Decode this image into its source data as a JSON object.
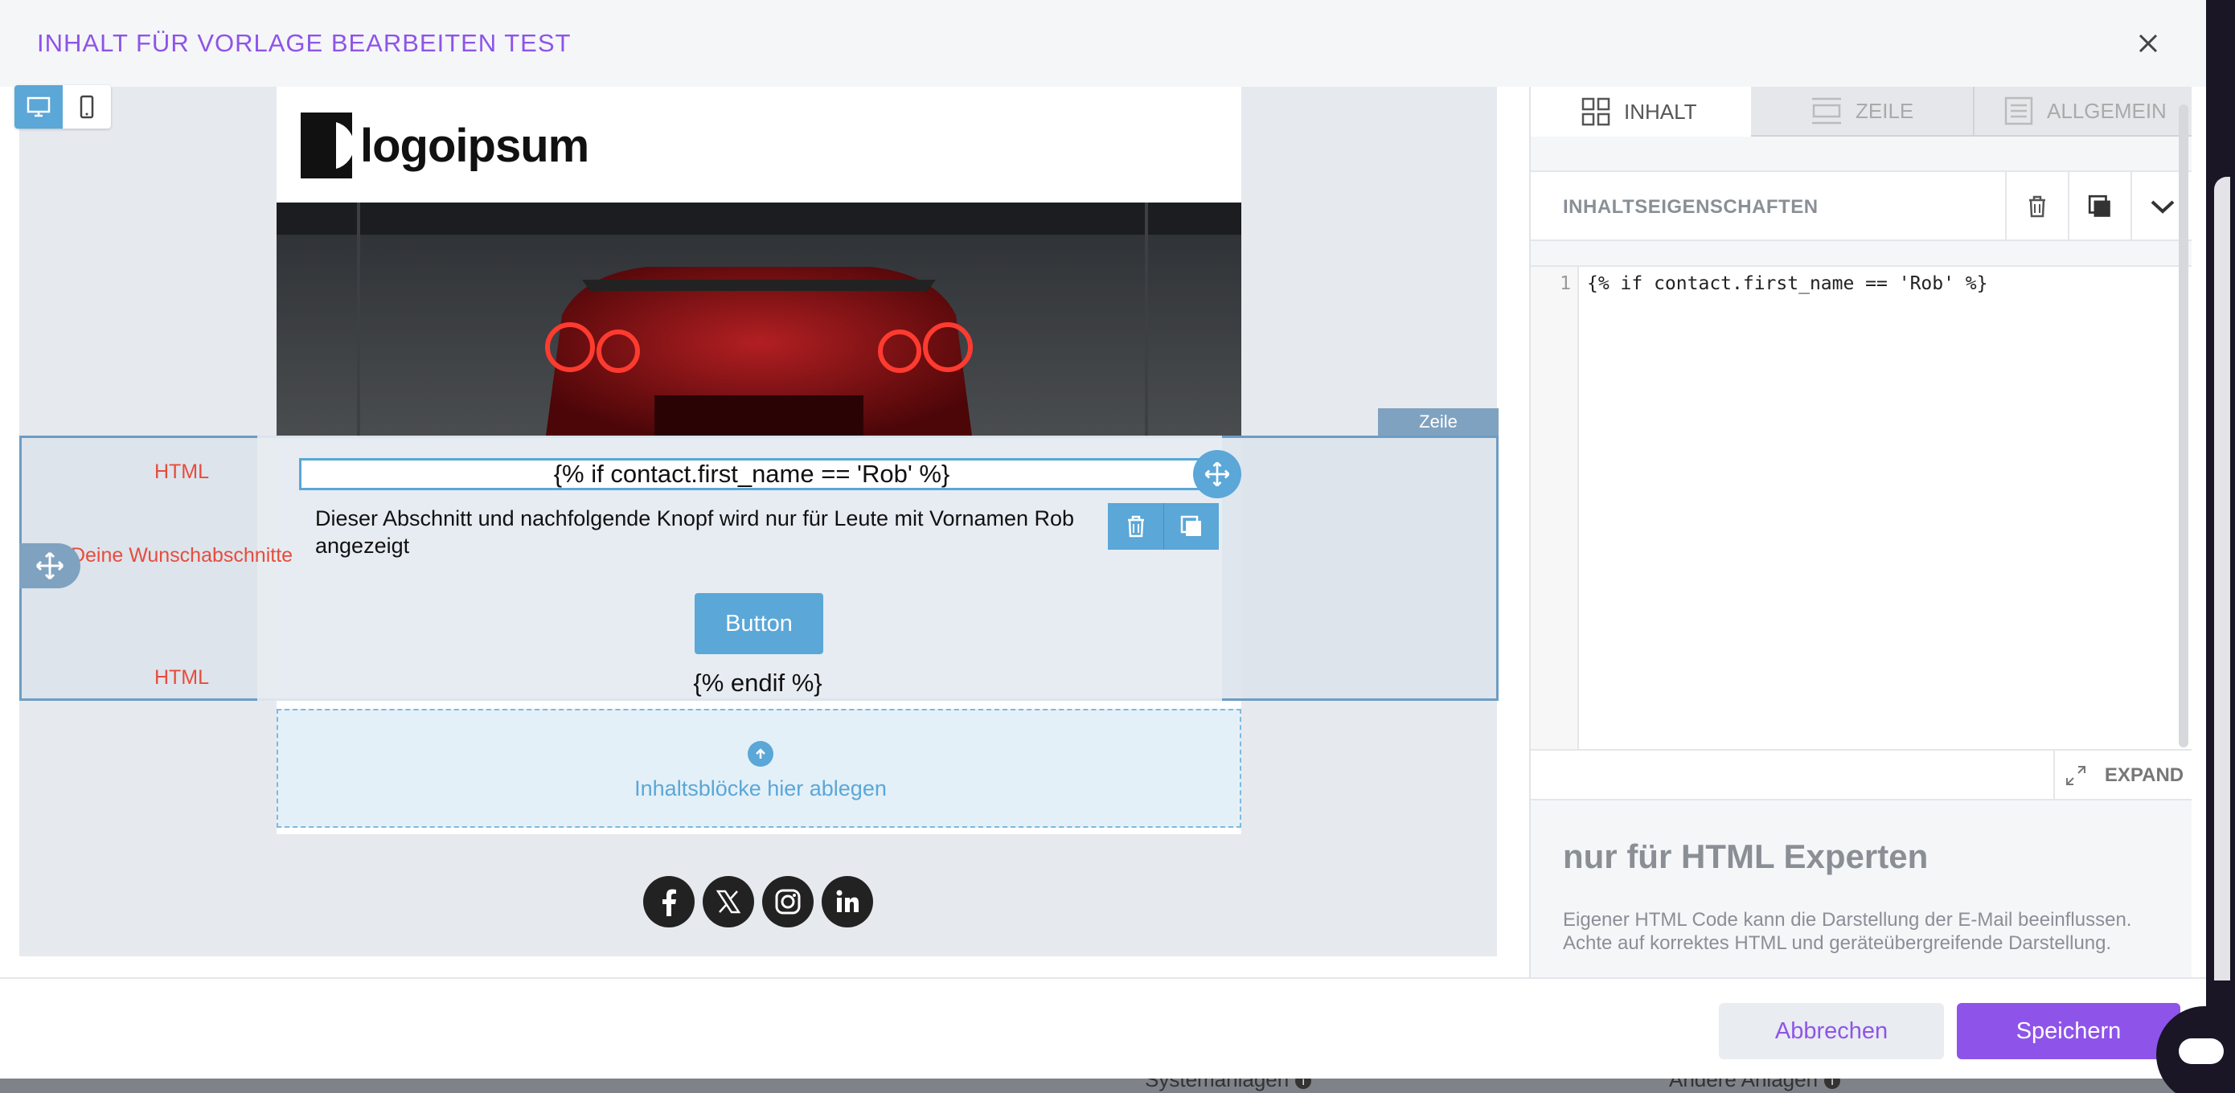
{
  "modal": {
    "title": "INHALT FÜR VORLAGE BEARBEITEN TEST"
  },
  "background_page": {
    "label_left": "Systemanlagen",
    "label_right": "Andere Anlagen"
  },
  "email": {
    "logo_text": "logoipsum",
    "row_tag": "Zeile",
    "side_labels": {
      "top": "HTML",
      "middle": "Deine Wunschabschnitte",
      "bottom": "HTML"
    },
    "if_block": "{% if contact.first_name == 'Rob' %}",
    "text_block": "Dieser Abschnitt und nachfolgende Knopf wird nur für Leute mit Vornamen Rob angezeigt",
    "button_label": "Button",
    "endif_block": "{% endif %}",
    "drop_zone": "Inhaltsblöcke hier ablegen",
    "social": [
      "facebook-icon",
      "x-icon",
      "instagram-icon",
      "linkedin-icon"
    ]
  },
  "panel": {
    "tabs": [
      {
        "label": "INHALT",
        "icon": "grid-icon"
      },
      {
        "label": "ZEILE",
        "icon": "rows-icon"
      },
      {
        "label": "ALLGEMEIN",
        "icon": "list-icon"
      }
    ],
    "props_title": "INHALTSEIGENSCHAFTEN",
    "code": {
      "line_number": "1",
      "line": "{% if contact.first_name == 'Rob' %}"
    },
    "expand_label": "EXPAND",
    "info_title": "nur für HTML Experten",
    "info_text": "Eigener HTML Code kann die Darstellung der E-Mail beeinflussen. Achte auf korrektes HTML und geräteübergreifende Darstellung."
  },
  "footer": {
    "cancel_label": "Abbrechen",
    "save_label": "Speichern"
  },
  "colors": {
    "accent": "#8e54e9",
    "blue": "#5aa7d8",
    "row_border": "#6d9cc4",
    "label_red": "#e74c3c"
  }
}
